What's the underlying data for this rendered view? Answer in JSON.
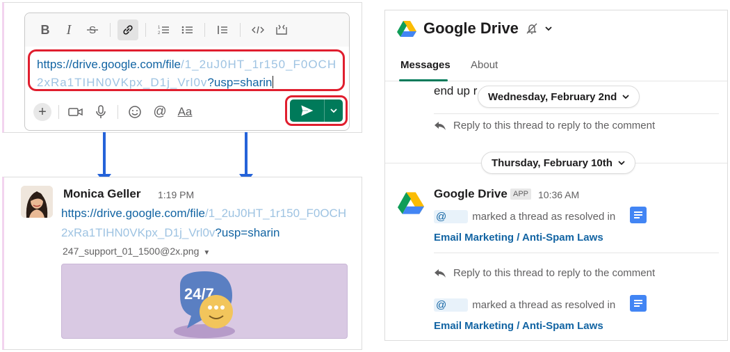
{
  "composer": {
    "toolbar": {
      "bold": "B",
      "italic": "I",
      "strike": "S",
      "link": "🔗",
      "ordered_list": "≔",
      "bullet_list": "☰",
      "quote": "⫶",
      "code": "</>",
      "code_block": "⌨"
    },
    "editor": {
      "line1_visible": "https://drive.google.com/file",
      "line1_blurred": "/1_2uJ0HT_1r150_F0OCH",
      "line2_blurred": "2xRa1TIHN0VKpx_D1j_Vrl0v",
      "line2_visible": "?usp=sharin"
    },
    "bottom": {
      "plus": "+",
      "aa": "Aa"
    }
  },
  "message": {
    "sender": "Monica Geller",
    "time": "1:19 PM",
    "link_line1_visible": "https://drive.google.com/file",
    "link_line1_blurred": "/1_2uJ0HT_1r150_F0OCH",
    "link_line2_blurred": "2xRa1TIHN0VKpx_D1j_Vrl0v",
    "link_line2_visible": "?usp=sharin",
    "file_name": "247_support_01_1500@2x.png",
    "preview_text": "24/7"
  },
  "channel": {
    "title": "Google Drive",
    "tabs": [
      "Messages",
      "About"
    ],
    "prev_message_text": "end up r                                           n't intend to.\"",
    "date1": "Wednesday, February 2nd",
    "reply_text": "Reply to this thread to reply to the comment",
    "date2": "Thursday, February 10th",
    "bot_name": "Google Drive",
    "app_badge": "APP",
    "bot_time": "10:36 AM",
    "mention_prefix": "@",
    "resolved_text": "marked a thread as resolved in",
    "doc_link": "Email Marketing / Anti-Spam Laws",
    "reply_text_2": "Reply to this thread to reply to the comment",
    "resolved_text_2": "marked a thread as resolved in",
    "doc_link_2": "Email Marketing / Anti-Spam Laws"
  },
  "colors": {
    "send_green": "#007a5a",
    "highlight_red": "#e01e2e",
    "arrow_blue": "#2563d9",
    "link_blue": "#1264a3"
  }
}
